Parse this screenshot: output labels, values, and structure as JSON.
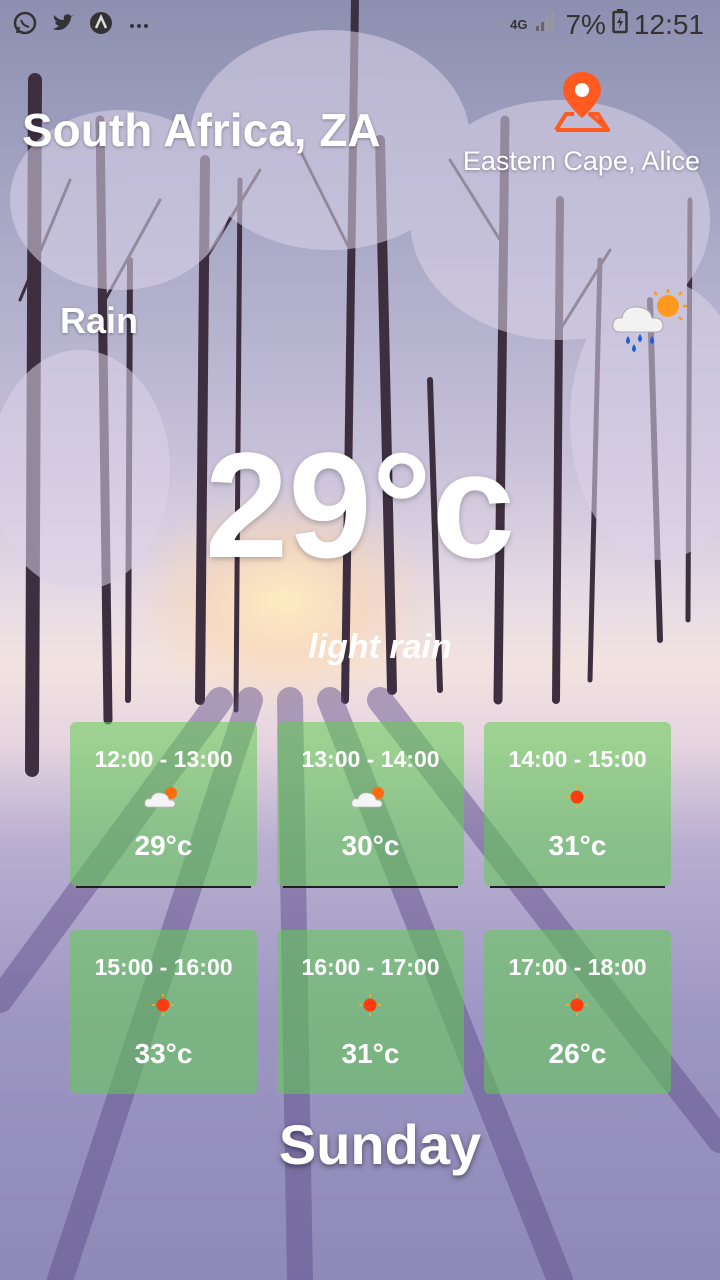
{
  "status_bar": {
    "left_icons": [
      "whatsapp-icon",
      "twitter-icon",
      "app-icon",
      "more-notifications-icon"
    ],
    "network": "4G",
    "battery": "7%",
    "time": "12:51"
  },
  "header": {
    "country": "South Africa, ZA",
    "region": "Eastern Cape, Alice"
  },
  "current": {
    "condition": "Rain",
    "condition_icon": "rain-cloud-sun-icon",
    "temperature": "29°c",
    "description": "light rain"
  },
  "forecast": [
    {
      "time": "12:00 - 13:00",
      "icon": "partly-cloudy-icon",
      "temp": "29°c"
    },
    {
      "time": "13:00 - 14:00",
      "icon": "partly-cloudy-icon",
      "temp": "30°c"
    },
    {
      "time": "14:00 - 15:00",
      "icon": "sun-icon",
      "temp": "31°c"
    },
    {
      "time": "15:00 - 16:00",
      "icon": "sun-icon",
      "temp": "33°c"
    },
    {
      "time": "16:00 - 17:00",
      "icon": "sun-icon",
      "temp": "31°c"
    },
    {
      "time": "17:00 - 18:00",
      "icon": "sun-icon",
      "temp": "26°c"
    }
  ],
  "day": "Sunday",
  "colors": {
    "pin_accent": "#ff5a1f",
    "card_background": "#60cd50",
    "text": "#ffffff"
  }
}
